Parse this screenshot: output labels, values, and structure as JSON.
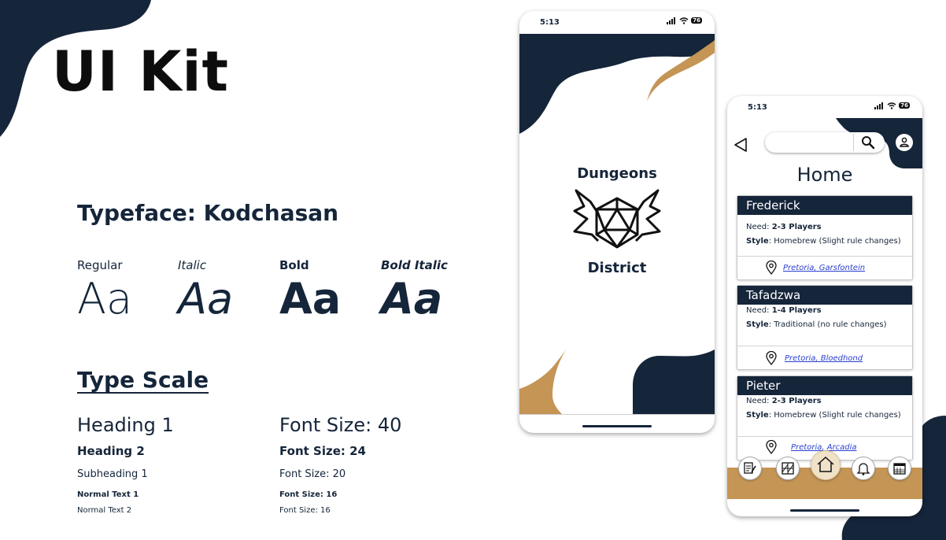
{
  "kit": {
    "title": "UI Kit"
  },
  "typeface": {
    "heading": "Typeface: Kodchasan"
  },
  "styles": [
    {
      "label": "Regular",
      "sample": "Aa"
    },
    {
      "label": "Italic",
      "sample": "Aa"
    },
    {
      "label": "Bold",
      "sample": "Aa"
    },
    {
      "label": "Bold Italic",
      "sample": "Aa"
    }
  ],
  "type_scale": {
    "heading": "Type Scale",
    "rows": [
      {
        "name": "Heading 1",
        "size": "Font Size: 40"
      },
      {
        "name": "Heading 2",
        "size": "Font Size: 24"
      },
      {
        "name": "Subheading 1",
        "size": "Font Size: 20"
      },
      {
        "name": "Normal Text 1",
        "size": "Font Size: 16"
      },
      {
        "name": "Normal Text 2",
        "size": "Font Size: 16"
      }
    ]
  },
  "splash": {
    "time": "5:13",
    "battery": "76",
    "logo_top": "Dungeons",
    "logo_bottom": "District"
  },
  "home": {
    "time": "5:13",
    "battery": "76",
    "title": "Home",
    "search_placeholder": "",
    "cards": [
      {
        "name": "Frederick",
        "need_label": "Need:",
        "need_value": "2-3 Players",
        "style_label": "Style",
        "style_value": ": Homebrew (Slight rule changes)",
        "location": "Pretoria, Garsfontein"
      },
      {
        "name": "Tafadzwa",
        "need_label": "Need:",
        "need_value": "1-4 Players",
        "style_label": "Style",
        "style_value": ": Traditional (no rule changes)",
        "location": "Pretoria, Bloedhond"
      },
      {
        "name": "Pieter",
        "need_label": "Need:",
        "need_value": "2-3 Players",
        "style_label": "Style",
        "style_value": ": Homebrew (Slight rule changes)",
        "location": "Pretoria, Arcadia"
      }
    ],
    "nav": [
      "notes-icon",
      "map-icon",
      "home-icon",
      "bell-icon",
      "calendar-icon"
    ]
  },
  "colors": {
    "navy": "#15253a",
    "gold": "#c49555",
    "link": "#2a3fd0"
  }
}
